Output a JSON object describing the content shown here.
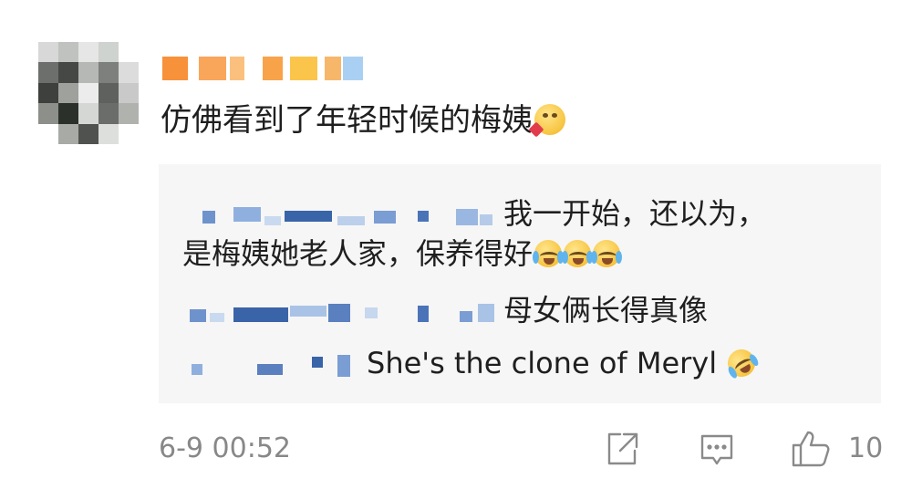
{
  "comment": {
    "text": "仿佛看到了年轻时候的梅姨",
    "emoji": "smirk-heart-emoji"
  },
  "replies": [
    {
      "text": "我一开始，还以为，",
      "text2": "是梅姨她老人家，保养得好",
      "emojis": [
        "laugh-cry-emoji",
        "laugh-cry-emoji",
        "laugh-cry-emoji"
      ]
    },
    {
      "text": "母女俩长得真像"
    },
    {
      "text": "She's the clone of Meryl",
      "emoji": "rofl-emoji"
    }
  ],
  "footer": {
    "timestamp": "6-9 00:52",
    "like_count": "10",
    "icons": [
      "share-icon",
      "comment-icon",
      "thumbs-up-icon"
    ]
  },
  "colors": {
    "background": "#ffffff",
    "reply_background": "#f6f6f6",
    "meta_text": "#888888",
    "username_pixels": [
      "#f79a3a",
      "#fbc24a",
      "#9cc9f0"
    ],
    "reply_name_pixels": [
      "#6e93cc",
      "#a9c3e6",
      "#3a64a8"
    ]
  }
}
